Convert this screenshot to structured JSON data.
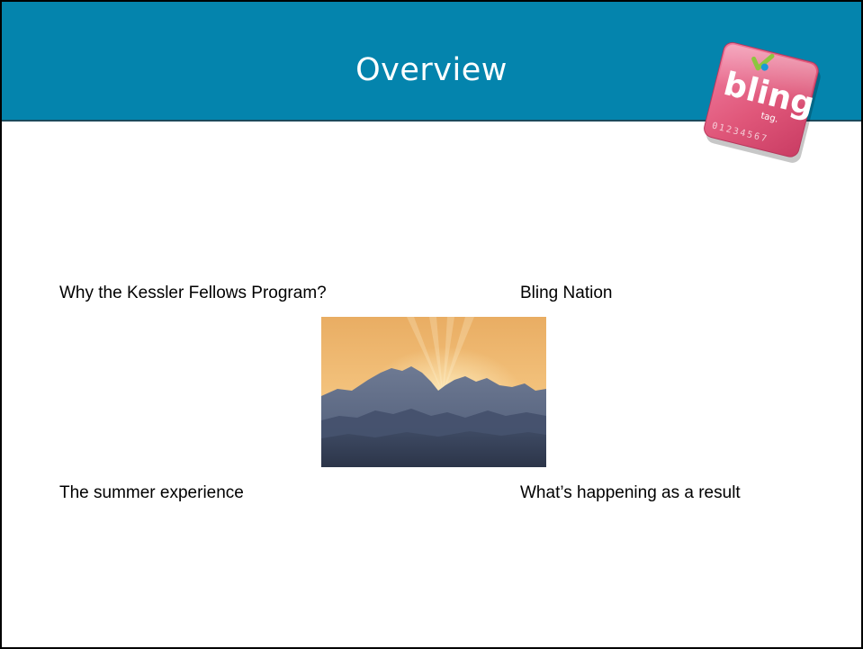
{
  "slide": {
    "title": "Overview",
    "logo": {
      "brand_text": "bling",
      "sub_text": "tag.",
      "digits": "01234567",
      "colors": {
        "tile": "#e0577a",
        "tile_edge": "#c93c63",
        "check": "#8cc63f",
        "figure": "#1a9ad6"
      }
    },
    "items": [
      "Why the Kessler Fellows Program?",
      "Bling Nation",
      "The summer experience",
      "What’s happening as a result"
    ],
    "image_subject": "mountain-sunset-photo"
  },
  "colors": {
    "title_bar": "#0484ad",
    "title_text": "#ffffff",
    "body_text": "#000000"
  }
}
